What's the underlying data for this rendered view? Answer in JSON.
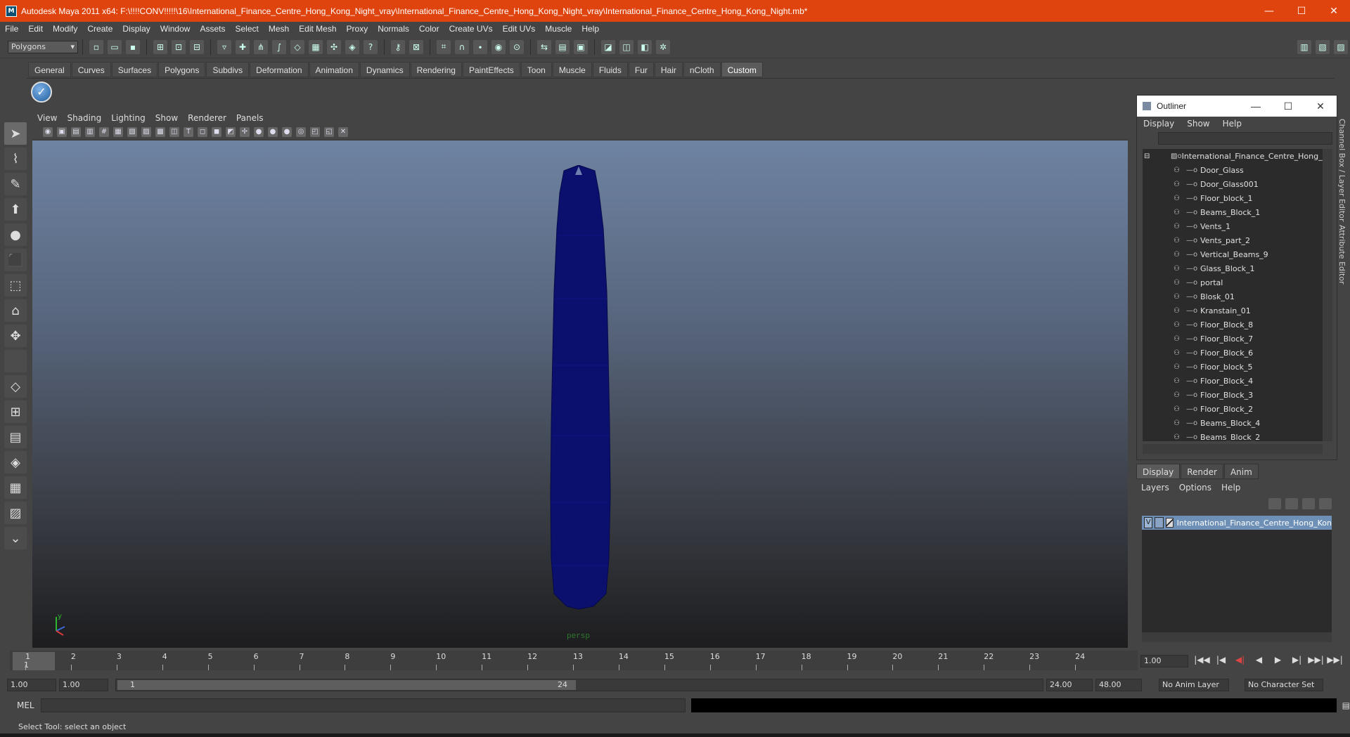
{
  "window": {
    "title": "Autodesk Maya 2011 x64: F:\\!!!!CONV!!!!!\\16\\International_Finance_Centre_Hong_Kong_Night_vray\\International_Finance_Centre_Hong_Kong_Night_vray\\International_Finance_Centre_Hong_Kong_Night.mb*",
    "minimize": "—",
    "maximize": "☐",
    "close": "✕"
  },
  "menubar": [
    "File",
    "Edit",
    "Modify",
    "Create",
    "Display",
    "Window",
    "Assets",
    "Select",
    "Mesh",
    "Edit Mesh",
    "Proxy",
    "Normals",
    "Color",
    "Create UVs",
    "Edit UVs",
    "Muscle",
    "Help"
  ],
  "toolbar": {
    "mode": "Polygons"
  },
  "shelf": {
    "tabs": [
      "General",
      "Curves",
      "Surfaces",
      "Polygons",
      "Subdivs",
      "Deformation",
      "Animation",
      "Dynamics",
      "Rendering",
      "PaintEffects",
      "Toon",
      "Muscle",
      "Fluids",
      "Fur",
      "Hair",
      "nCloth",
      "Custom"
    ],
    "active_tab": "Custom"
  },
  "viewport": {
    "menu": [
      "View",
      "Shading",
      "Lighting",
      "Show",
      "Renderer",
      "Panels"
    ],
    "camera": "persp",
    "object_color": "#0b0f6e"
  },
  "outliner": {
    "title": "Outliner",
    "menu": [
      "Display",
      "Show",
      "Help"
    ],
    "root": "International_Finance_Centre_Hong_Ko",
    "items": [
      "Door_Glass",
      "Door_Glass001",
      "Floor_block_1",
      "Beams_Block_1",
      "Vents_1",
      "Vents_part_2",
      "Vertical_Beams_9",
      "Glass_Block_1",
      "portal",
      "Blosk_01",
      "Kranstain_01",
      "Floor_Block_8",
      "Floor_Block_7",
      "Floor_Block_6",
      "Floor_block_5",
      "Floor_Block_4",
      "Floor_Block_3",
      "Floor_Block_2",
      "Beams_Block_4",
      "Beams_Block_2"
    ]
  },
  "side_tabs": [
    "Channel Box / Layer Editor",
    "Attribute Editor"
  ],
  "layers": {
    "tabs": [
      "Display",
      "Render",
      "Anim"
    ],
    "active_tab": "Display",
    "menu": [
      "Layers",
      "Options",
      "Help"
    ],
    "layer_name": "International_Finance_Centre_Hong_Kon",
    "visible_flag": "V"
  },
  "timeline": {
    "ticks": [
      "1",
      "2",
      "3",
      "4",
      "5",
      "6",
      "7",
      "8",
      "9",
      "10",
      "11",
      "12",
      "13",
      "14",
      "15",
      "16",
      "17",
      "18",
      "19",
      "20",
      "21",
      "22",
      "23",
      "24"
    ],
    "current_frame_marker": "1",
    "current_frame": "1.00"
  },
  "range": {
    "start": "1.00",
    "playback_start": "1.00",
    "slider_start": "1",
    "slider_end": "24",
    "playback_end": "24.00",
    "end": "48.00",
    "anim_layer": "No Anim Layer",
    "char_set": "No Character Set"
  },
  "command": {
    "label": "MEL"
  },
  "status": {
    "text": "Select Tool: select an object"
  }
}
